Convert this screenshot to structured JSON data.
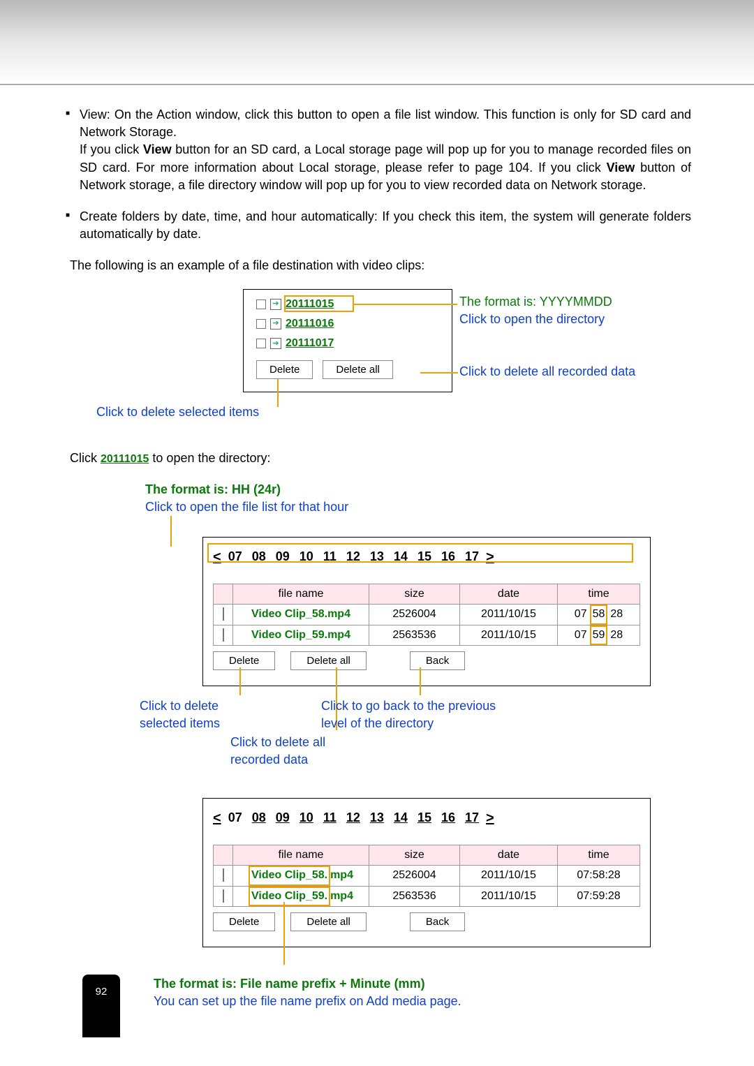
{
  "bullets": {
    "view_text": "View: On the Action window, click this button to open a file list window. This function is only for SD card and Network Storage.",
    "view_para2_a": "If you click ",
    "view_para2_b": " button for an SD card, a Local storage page will pop up for you to manage recorded files on SD card. For more information about Local storage, please refer to page 104. If you click ",
    "view_para2_c": " button of Network storage, a file directory window will pop up for you to view recorded data on Network storage.",
    "view_bold1": "View",
    "view_bold2": "View",
    "create_text": "Create folders by date, time, and hour automatically: If you check this item, the system will generate folders automatically by date."
  },
  "para_following": "The following is an example of a file destination with video clips:",
  "folders": [
    "20111015",
    "20111016",
    "20111017"
  ],
  "buttons": {
    "delete": "Delete",
    "delete_all": "Delete all",
    "back": "Back"
  },
  "annotations": {
    "format_ymd": "The format is: YYYYMMDD",
    "open_dir": "Click to open the directory",
    "delete_all_rec": "Click to delete all recorded data",
    "delete_sel": "Click to delete selected items",
    "click_open_pre": "Click ",
    "click_open_link": "20111015",
    "click_open_post": " to open the directory:",
    "format_hh": "The format is: HH (24r)",
    "open_hour": "Click to open the file list for that hour",
    "del_sel2": "Click to delete\nselected items",
    "del_all2": "Click to delete all\nrecorded data",
    "go_back": "Click to go back to the previous\nlevel of the directory",
    "format_prefix": "The format is: File name prefix + Minute (mm)",
    "prefix_note": "You can set up the file name prefix on Add media page."
  },
  "hours": [
    "07",
    "08",
    "09",
    "10",
    "11",
    "12",
    "13",
    "14",
    "15",
    "16",
    "17"
  ],
  "table_headers": {
    "fname": "file name",
    "size": "size",
    "date": "date",
    "time": "time"
  },
  "files": [
    {
      "name": "Video Clip_58.mp4",
      "size": "2526004",
      "date": "2011/10/15",
      "time": "07:58:28",
      "time_parts": [
        "07",
        "58",
        "28"
      ],
      "name_parts": [
        "Video Clip_58.",
        "mp4"
      ]
    },
    {
      "name": "Video Clip_59.mp4",
      "size": "2563536",
      "date": "2011/10/15",
      "time": "07:59:28",
      "time_parts": [
        "07",
        "59",
        "28"
      ],
      "name_parts": [
        "Video Clip_59.",
        "mp4"
      ]
    }
  ],
  "page_number": "92",
  "nav": {
    "lt": "<",
    "gt": ">"
  }
}
